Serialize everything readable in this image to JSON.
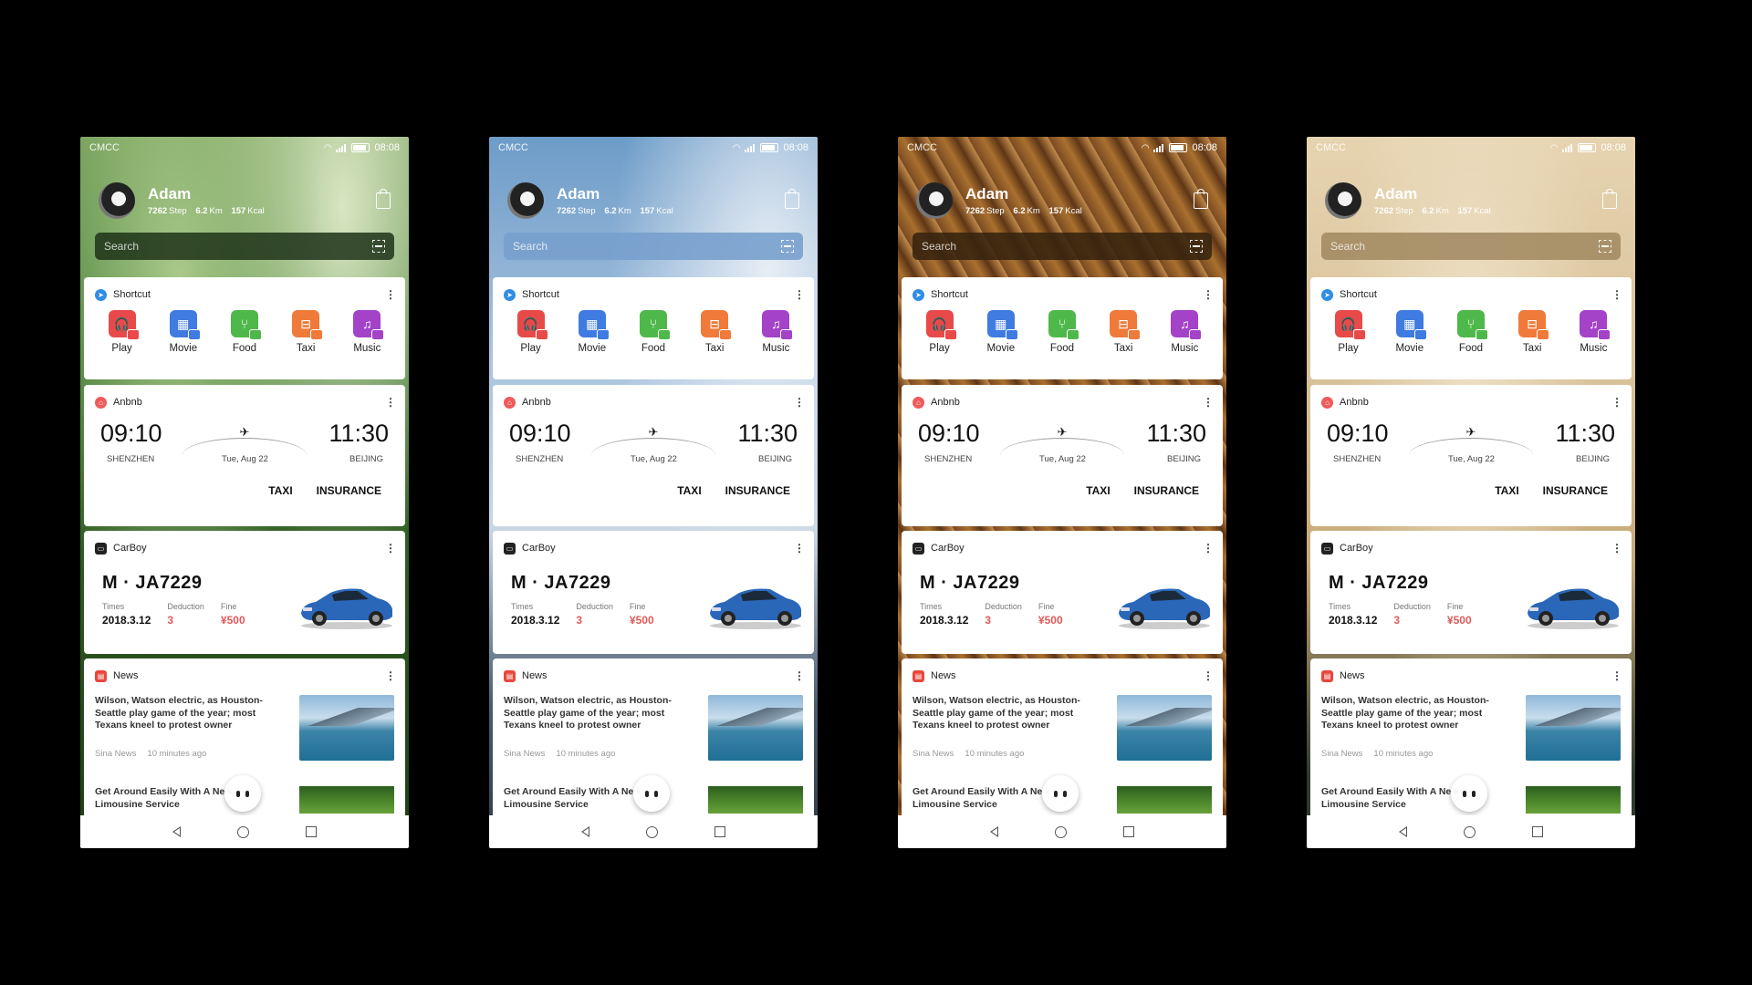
{
  "status": {
    "carrier": "CMCC",
    "time": "08:08"
  },
  "profile": {
    "name": "Adam",
    "steps": "7262",
    "steps_unit": "Step",
    "distance": "6.2",
    "distance_unit": "Km",
    "kcal": "157",
    "kcal_unit": "Kcal"
  },
  "search": {
    "placeholder": "Search"
  },
  "shortcut": {
    "title": "Shortcut",
    "apps": [
      {
        "label": "Play",
        "icon": "headphones-icon",
        "color": "#e84a4a"
      },
      {
        "label": "Movie",
        "icon": "film-icon",
        "color": "#3f7be0"
      },
      {
        "label": "Food",
        "icon": "fork-knife-icon",
        "color": "#4fb84a"
      },
      {
        "label": "Taxi",
        "icon": "car-icon",
        "color": "#f07a3a"
      },
      {
        "label": "Music",
        "icon": "music-note-icon",
        "color": "#a443c8"
      }
    ]
  },
  "flight": {
    "app": "Anbnb",
    "depart_time": "09:10",
    "arrive_time": "11:30",
    "from": "SHENZHEN",
    "date": "Tue, Aug 22",
    "to": "BEIJING",
    "action_taxi": "TAXI",
    "action_insurance": "INSURANCE"
  },
  "car": {
    "app": "CarBoy",
    "plate": "M · JA7229",
    "times_label": "Times",
    "times_value": "2018.3.12",
    "deduction_label": "Deduction",
    "deduction_value": "3",
    "fine_label": "Fine",
    "fine_value": "¥500"
  },
  "news": {
    "title": "News",
    "items": [
      {
        "headline": "Wilson, Watson electric, as Houston-Seattle play game of the year; most Texans kneel to protest owner",
        "source": "Sina News",
        "time": "10 minutes ago"
      },
      {
        "headline": "Get Around Easily With A Ne     k Limousine Service"
      }
    ]
  },
  "themes": [
    "green-hills",
    "blue-sky",
    "brown-fur",
    "sand-dunes"
  ]
}
